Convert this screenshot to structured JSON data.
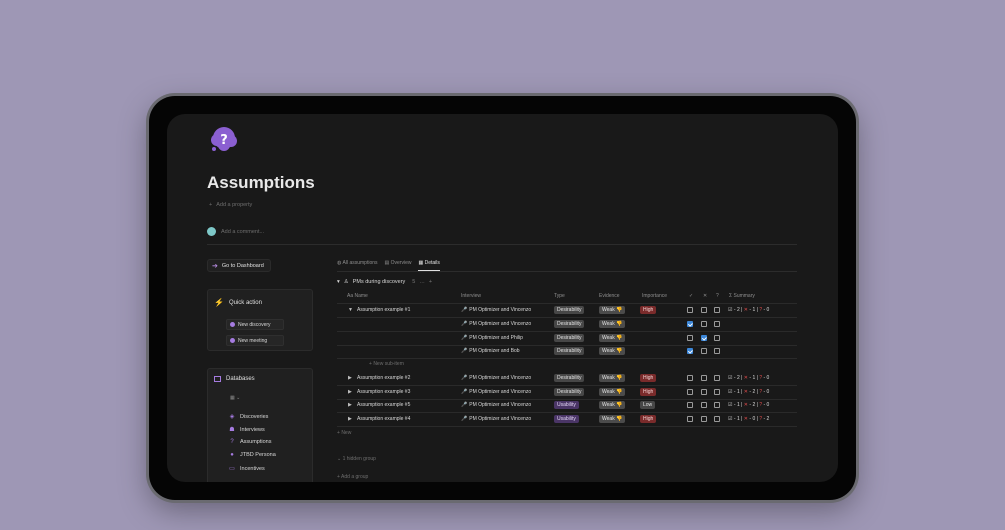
{
  "page": {
    "title": "Assumptions",
    "add_property": "Add a property",
    "add_comment": "Add a comment..."
  },
  "sidebar": {
    "dashboard_button": "Go to Dashboard",
    "quick_action": {
      "title": "Quick action",
      "buttons": [
        "New discovery",
        "New meeting"
      ]
    },
    "databases": {
      "title": "Databases",
      "view_selector": "",
      "items": [
        {
          "label": "Discoveries",
          "icon": "discovery-icon"
        },
        {
          "label": "Interviews",
          "icon": "people-icon"
        },
        {
          "label": "Assumptions",
          "icon": "question-icon"
        },
        {
          "label": "JTBD Persona",
          "icon": "person-icon"
        },
        {
          "label": "Incentives",
          "icon": "ticket-icon"
        }
      ]
    }
  },
  "views": {
    "tabs": [
      "All assumptions",
      "Overview",
      "Details"
    ],
    "active": "Details"
  },
  "group": {
    "label": "PMs during discovery",
    "count": "5",
    "more": "…",
    "add": "+"
  },
  "columns": [
    "Aa Name",
    "Interview",
    "Type",
    "Evidence",
    "Importance",
    "✓",
    "✕",
    "?",
    "Σ Summary"
  ],
  "rows": [
    {
      "name": "Assumption example #1",
      "expanded": true,
      "interview": "PM Optimizer and Vincenzo",
      "type": "Desirability",
      "evidence": "Weak",
      "importance": "High",
      "checks": [
        false,
        false,
        false
      ],
      "summary": {
        "yes": "2",
        "no": "1",
        "unknown": "0"
      }
    },
    {
      "name": "",
      "sub": true,
      "interview": "PM Optimizer and Vincenzo",
      "type": "Desirability",
      "evidence": "Weak",
      "importance": "",
      "checks": [
        true,
        false,
        false
      ]
    },
    {
      "name": "",
      "sub": true,
      "interview": "PM Optimizer and Philip",
      "type": "Desirability",
      "evidence": "Weak",
      "importance": "",
      "checks": [
        false,
        true,
        false
      ]
    },
    {
      "name": "",
      "sub": true,
      "interview": "PM Optimizer and Bob",
      "type": "Desirability",
      "evidence": "Weak",
      "importance": "",
      "checks": [
        true,
        false,
        false
      ]
    },
    {
      "name": "Assumption example #2",
      "interview": "PM Optimizer and Vincenzo",
      "type": "Desirability",
      "evidence": "Weak",
      "importance": "High",
      "checks": [
        false,
        false,
        false
      ],
      "summary": {
        "yes": "2",
        "no": "1",
        "unknown": "0"
      }
    },
    {
      "name": "Assumption example #3",
      "interview": "PM Optimizer and Vincenzo",
      "type": "Desirability",
      "evidence": "Weak",
      "importance": "High",
      "checks": [
        false,
        false,
        false
      ],
      "summary": {
        "yes": "1",
        "no": "2",
        "unknown": "0"
      }
    },
    {
      "name": "Assumption example #5",
      "interview": "PM Optimizer and Vincenzo",
      "type": "Usability",
      "evidence": "Weak",
      "importance": "Low",
      "checks": [
        false,
        false,
        false
      ],
      "summary": {
        "yes": "1",
        "no": "2",
        "unknown": "0"
      }
    },
    {
      "name": "Assumption example #4",
      "interview": "PM Optimizer and Vincenzo",
      "type": "Usability",
      "evidence": "Weak",
      "importance": "High",
      "checks": [
        false,
        false,
        false
      ],
      "summary": {
        "yes": "1",
        "no": "0",
        "unknown": "2"
      }
    }
  ],
  "new_sub_item": "New sub-item",
  "new_row": "New",
  "hidden_groups": "1 hidden group",
  "add_group": "Add a group",
  "colors": {
    "accent": "#a57be0",
    "background": "#191919",
    "checkbox_on": "#3b86d8",
    "high_tag": "#7a2b2b",
    "usability_tag": "#4a3566"
  }
}
